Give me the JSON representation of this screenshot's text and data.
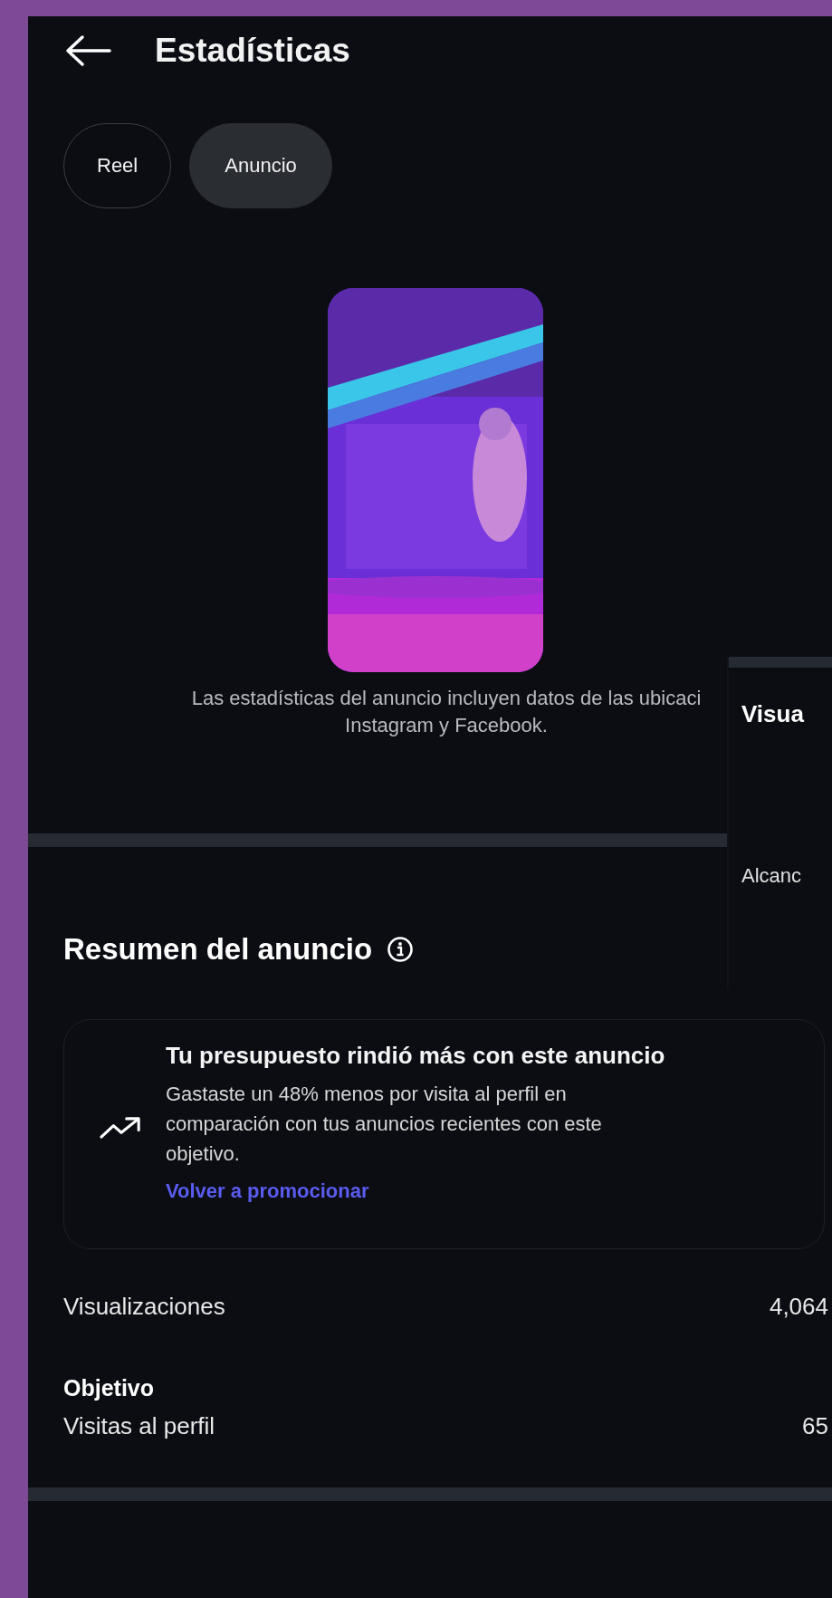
{
  "header": {
    "title": "Estadísticas"
  },
  "tabs": [
    {
      "label": "Reel",
      "selected": false
    },
    {
      "label": "Anuncio",
      "selected": true
    }
  ],
  "caption_lines": [
    "Las estadísticas del anuncio incluyen datos de las ubicaci",
    "Instagram y Facebook."
  ],
  "summary": {
    "title": "Resumen del anuncio"
  },
  "insight": {
    "title": "Tu presupuesto rindió más con este anuncio",
    "body": "Gastaste un 48% menos por visita al perfil en comparación con tus anuncios recientes con este objetivo.",
    "link": "Volver a promocionar"
  },
  "metrics": [
    {
      "label": "Visualizaciones",
      "value": "4,064"
    }
  ],
  "objective": {
    "heading": "Objetivo",
    "label": "Visitas al perfil",
    "value": "65"
  },
  "overlay_panel": {
    "title": "Visua",
    "label": "Alcanc"
  }
}
